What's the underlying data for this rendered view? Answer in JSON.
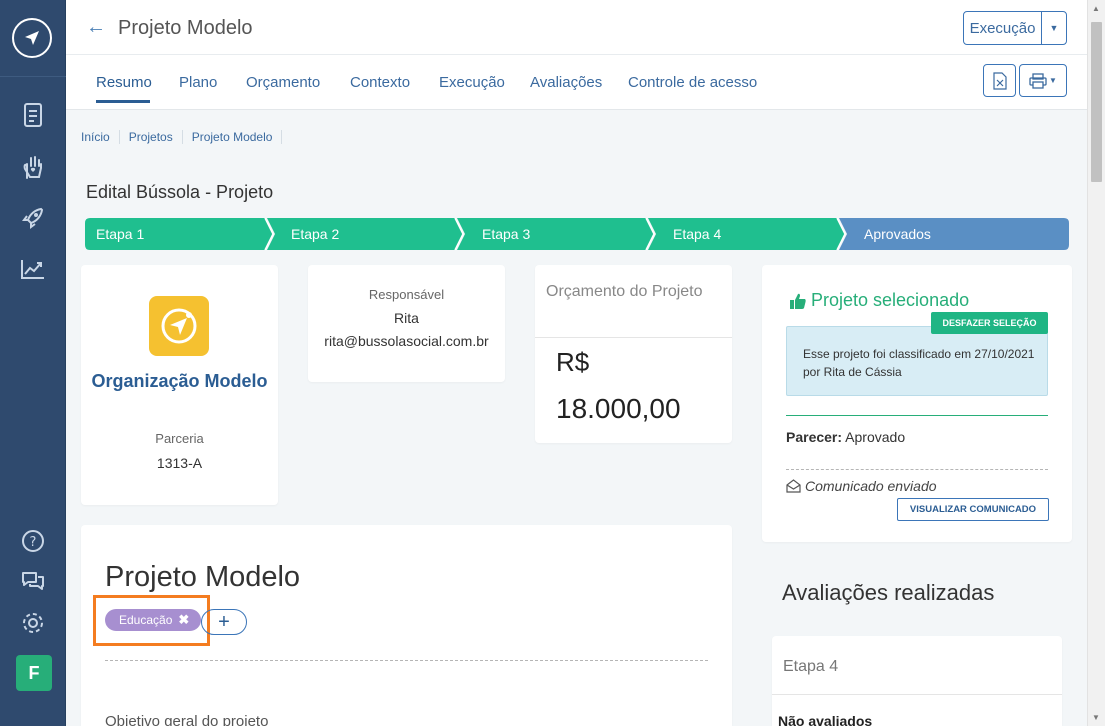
{
  "header": {
    "title": "Projeto Modelo",
    "exec_button": "Execução"
  },
  "tabs": [
    "Resumo",
    "Plano",
    "Orçamento",
    "Contexto",
    "Execução",
    "Avaliações",
    "Controle de acesso"
  ],
  "breadcrumb": [
    "Início",
    "Projetos",
    "Projeto Modelo"
  ],
  "edital": "Edital Bússola - Projeto",
  "steps": [
    "Etapa 1",
    "Etapa 2",
    "Etapa 3",
    "Etapa 4",
    "Aprovados"
  ],
  "organization": {
    "name": "Organização Modelo",
    "type": "Parceria",
    "code": "1313-A"
  },
  "responsible": {
    "label": "Responsável",
    "name": "Rita",
    "email": "rita@bussolasocial.com.br"
  },
  "budget": {
    "label": "Orçamento do Projeto",
    "currency": "R$",
    "value": "18.000,00"
  },
  "selection": {
    "title": "Projeto selecionado",
    "undo_button": "DESFAZER SELEÇÃO",
    "message": "Esse projeto foi classificado em 27/10/2021 por Rita de Cássia",
    "parecer_label": "Parecer:",
    "parecer_value": "Aprovado",
    "communication": "Comunicado enviado",
    "view_button": "VISUALIZAR COMUNICADO"
  },
  "project": {
    "title": "Projeto Modelo",
    "tag": "Educação",
    "add_tag": "+",
    "objective_label": "Objetivo geral do projeto"
  },
  "evaluations": {
    "title": "Avaliações realizadas",
    "stage": "Etapa 4",
    "not_evaluated": "Não avaliados"
  },
  "user": {
    "initial": "F"
  },
  "colors": {
    "sidebar": "#2f4a6e",
    "step_green": "#1fbf8f",
    "step_blue": "#5a8fc4",
    "accent": "#2b5d93",
    "success": "#27ae79",
    "tag": "#a78fd0",
    "highlight": "#f47c20"
  }
}
